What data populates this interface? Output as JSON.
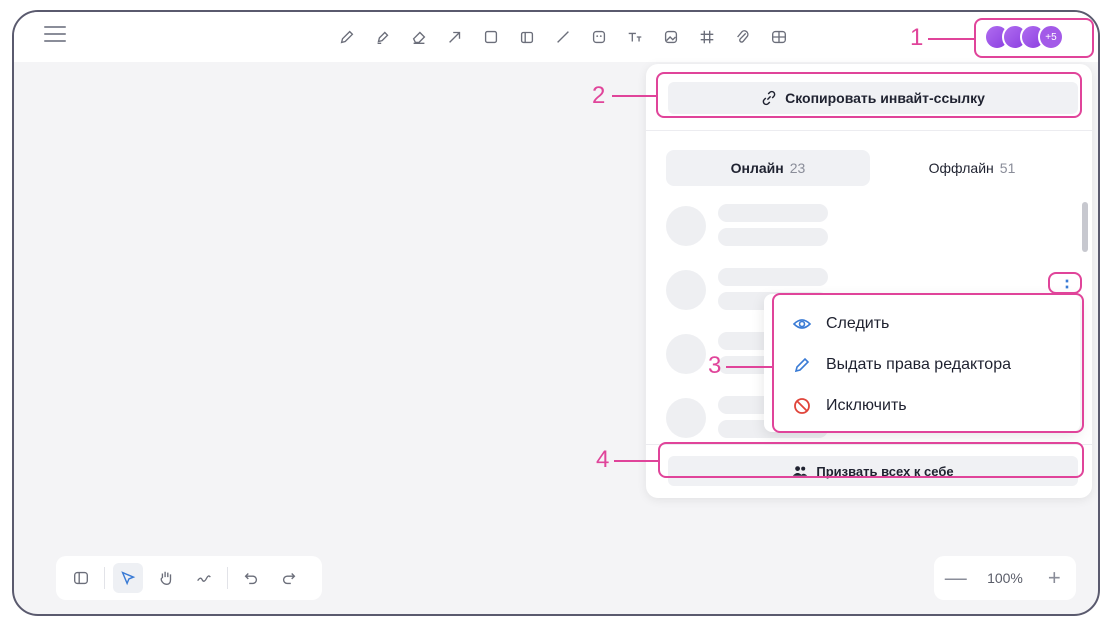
{
  "topbar": {
    "tools": [
      "pencil-icon",
      "marker-icon",
      "eraser-icon",
      "arrow-icon",
      "rectangle-icon",
      "sticky-note-icon",
      "line-icon",
      "sticker-icon",
      "text-icon",
      "image-icon",
      "grid-icon",
      "attachment-icon",
      "table-icon"
    ],
    "avatars_more": "+5"
  },
  "annotations": {
    "n1": "1",
    "n2": "2",
    "n3": "3",
    "n4": "4"
  },
  "panel": {
    "invite_label": "Скопировать инвайт-ссылку",
    "tab_online": "Онлайн",
    "online_count": "23",
    "tab_offline": "Оффлайн",
    "offline_count": "51",
    "more_label": "⋮",
    "summon_label": "Призвать всех к себе"
  },
  "context_menu": {
    "follow": "Следить",
    "grant_editor": "Выдать права редактора",
    "kick": "Исключить"
  },
  "zoom": {
    "minus": "—",
    "value": "100%",
    "plus": "+"
  },
  "colors": {
    "accent": "#e0449a",
    "avatar": "#a35ae8",
    "link_blue": "#3a7bd5",
    "danger": "#e0443a"
  }
}
